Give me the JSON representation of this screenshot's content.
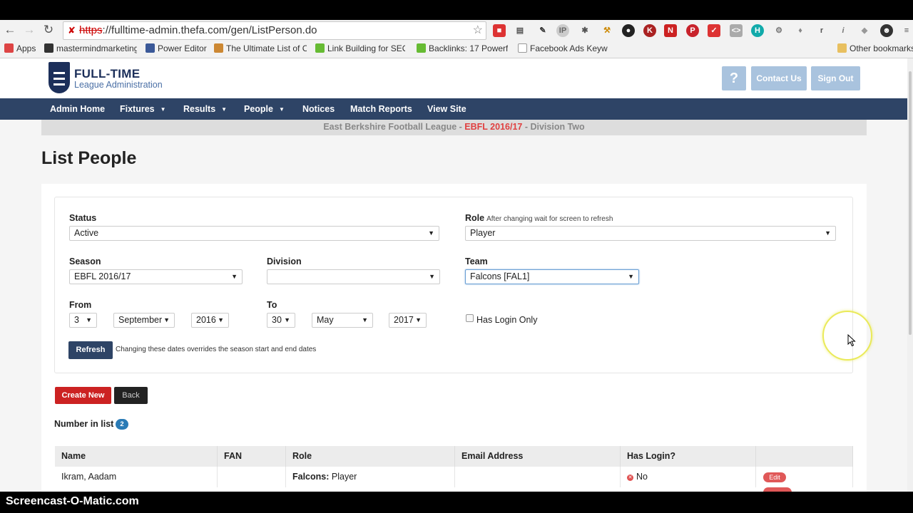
{
  "browser": {
    "url_scheme": "https",
    "url_rest": "://fulltime-admin.thefa.com/gen/ListPerson.do",
    "bookmarks": [
      {
        "label": "Apps",
        "icon": "apps-icon"
      },
      {
        "label": "mastermindmarketing",
        "icon": "m-icon"
      },
      {
        "label": "Power Editor",
        "icon": "facebook-icon"
      },
      {
        "label": "The Ultimate List of C",
        "icon": "list-icon"
      },
      {
        "label": "Link Building for SEO:",
        "icon": "globe-icon"
      },
      {
        "label": "Backlinks: 17 Powerfu",
        "icon": "globe-icon"
      },
      {
        "label": "Facebook Ads Keywo",
        "icon": "page-icon"
      },
      {
        "label": "Other bookmarks",
        "icon": "folder-icon"
      }
    ]
  },
  "header": {
    "logo_title": "FULL-TIME",
    "logo_subtitle": "League Administration",
    "help_label": "?",
    "contact_label": "Contact Us",
    "signout_label": "Sign Out"
  },
  "nav": {
    "items": [
      {
        "label": "Admin Home"
      },
      {
        "label": "Fixtures"
      },
      {
        "label": "Results"
      },
      {
        "label": "People"
      },
      {
        "label": "Notices"
      },
      {
        "label": "Match Reports"
      },
      {
        "label": "View Site"
      }
    ]
  },
  "subbar": {
    "league": "East Berkshire Football League - ",
    "season": "EBFL 2016/17",
    "division": " - Division Two"
  },
  "page_title": "List People",
  "filters": {
    "status_label": "Status",
    "status_value": "Active",
    "role_label": "Role",
    "role_hint": "After changing wait for screen to refresh",
    "role_value": "Player",
    "season_label": "Season",
    "season_value": "EBFL 2016/17",
    "division_label": "Division",
    "division_value": "",
    "team_label": "Team",
    "team_value": "Falcons [FAL1]",
    "from_label": "From",
    "from_day": "3",
    "from_month": "September",
    "from_year": "2016",
    "to_label": "To",
    "to_day": "30",
    "to_month": "May",
    "to_year": "2017",
    "has_login_label": "Has Login Only",
    "has_login_checked": false,
    "refresh_label": "Refresh",
    "refresh_hint": "Changing these dates overrides the season start and end dates"
  },
  "actions": {
    "create_label": "Create New",
    "back_label": "Back"
  },
  "list": {
    "count_label": "Number in list",
    "count": "2",
    "columns": [
      "Name",
      "FAN",
      "Role",
      "Email Address",
      "Has Login?",
      ""
    ],
    "rows": [
      {
        "name": "Ikram, Aadam",
        "fan": "",
        "role_team": "Falcons:",
        "role": " Player",
        "email": "",
        "has_login": "No",
        "edit_label": "Edit"
      }
    ]
  },
  "recorder": {
    "watermark": "Screencast-O-Matic.com"
  },
  "colors": {
    "nav_bg": "#2e4466",
    "accent_red": "#cc2222",
    "header_btn": "#a9c3de"
  }
}
